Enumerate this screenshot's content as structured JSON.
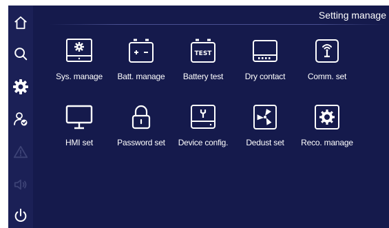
{
  "header": {
    "title": "Setting manage"
  },
  "sidebar": {
    "items": [
      {
        "icon": "home-icon",
        "state": "normal"
      },
      {
        "icon": "search-icon",
        "state": "normal"
      },
      {
        "icon": "gear-icon",
        "state": "active"
      },
      {
        "icon": "user-check-icon",
        "state": "normal"
      },
      {
        "icon": "warning-icon",
        "state": "disabled"
      },
      {
        "icon": "speaker-icon",
        "state": "disabled"
      },
      {
        "icon": "power-icon",
        "state": "normal"
      }
    ]
  },
  "menu": {
    "items": [
      {
        "label": "Sys. manage",
        "icon": "system-settings-icon"
      },
      {
        "label": "Batt. manage",
        "icon": "battery-icon"
      },
      {
        "label": "Battery test",
        "icon": "battery-test-icon",
        "icon_text": "TEST"
      },
      {
        "label": "Dry contact",
        "icon": "dry-contact-icon"
      },
      {
        "label": "Comm. set",
        "icon": "antenna-icon"
      },
      {
        "label": "HMI set",
        "icon": "monitor-icon"
      },
      {
        "label": "Password set",
        "icon": "lock-icon"
      },
      {
        "label": "Device config.",
        "icon": "device-config-icon"
      },
      {
        "label": "Dedust set",
        "icon": "fan-icon"
      },
      {
        "label": "Reco. manage",
        "icon": "record-gear-icon"
      }
    ]
  },
  "colors": {
    "background": "#151a4c",
    "sidebar": "#1b2056",
    "icon": "#ffffff",
    "disabled": "#3c4275"
  }
}
